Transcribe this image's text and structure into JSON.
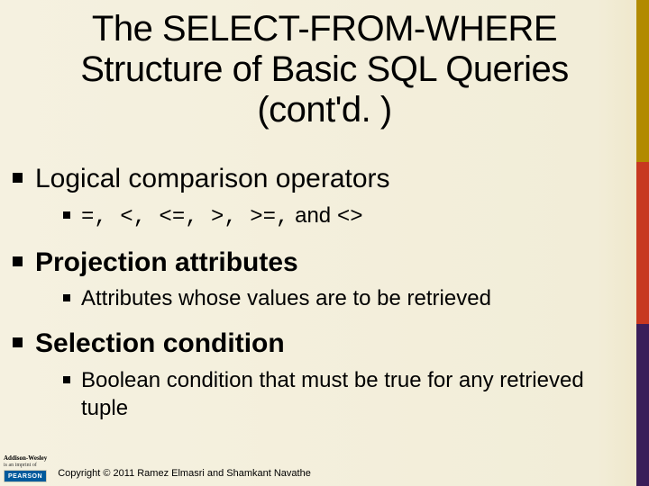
{
  "slide": {
    "title": "The SELECT-FROM-WHERE Structure of Basic SQL Queries (cont'd. )",
    "bullets": [
      {
        "text": "Logical comparison operators",
        "bold": false,
        "sub": [
          {
            "mono_prefix": "=, <, <=, >, >=,",
            "tail": " and ",
            "mono_suffix": "<>"
          }
        ]
      },
      {
        "text": "Projection attributes",
        "bold": true,
        "sub": [
          {
            "plain": "Attributes whose values are to be retrieved"
          }
        ]
      },
      {
        "text": "Selection condition",
        "bold": true,
        "sub": [
          {
            "plain": "Boolean condition that must be true for any retrieved tuple"
          }
        ]
      }
    ]
  },
  "footer": {
    "publisher_line1": "Addison-Wesley",
    "publisher_line2": "is an imprint of",
    "logo_text": "PEARSON",
    "copyright": "Copyright © 2011 Ramez Elmasri and Shamkant Navathe"
  }
}
